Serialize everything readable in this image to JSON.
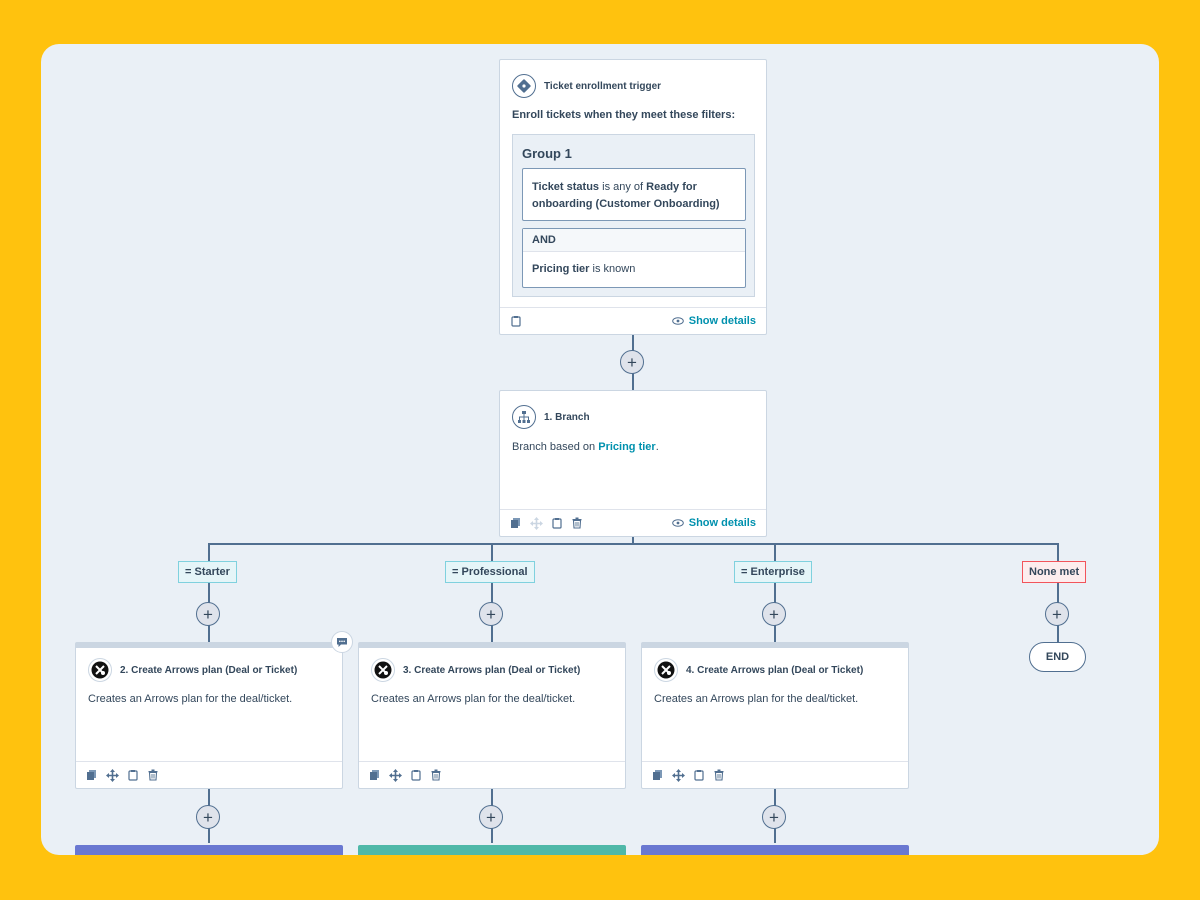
{
  "trigger": {
    "title": "Ticket enrollment trigger",
    "subtitle": "Enroll tickets when they meet these filters:",
    "group_title": "Group 1",
    "filter1_prop": "Ticket status",
    "filter1_op": " is any of ",
    "filter1_val": "Ready for onboarding (Customer Onboarding)",
    "and_label": "AND",
    "filter2_prop": "Pricing tier",
    "filter2_op": " is known",
    "show_details": "Show details"
  },
  "branch": {
    "title": "1. Branch",
    "text_prefix": "Branch based on ",
    "text_link": "Pricing tier",
    "text_suffix": ".",
    "show_details": "Show details"
  },
  "branches": [
    {
      "label": "= Starter"
    },
    {
      "label": "= Professional"
    },
    {
      "label": "= Enterprise"
    },
    {
      "label": "None met"
    }
  ],
  "actions": [
    {
      "title": "2. Create Arrows plan (Deal or Ticket)",
      "text": "Creates an Arrows plan for the deal/ticket."
    },
    {
      "title": "3. Create Arrows plan (Deal or Ticket)",
      "text": "Creates an Arrows plan for the deal/ticket."
    },
    {
      "title": "4. Create Arrows plan (Deal or Ticket)",
      "text": "Creates an Arrows plan for the deal/ticket."
    }
  ],
  "end_label": "END",
  "plus_symbol": "+",
  "colors": {
    "background": "#FFC20E",
    "canvas": "#eaf0f6",
    "link": "#0091ae",
    "card_next_purple": "#6a78d1",
    "card_next_teal": "#4fb8a8"
  }
}
